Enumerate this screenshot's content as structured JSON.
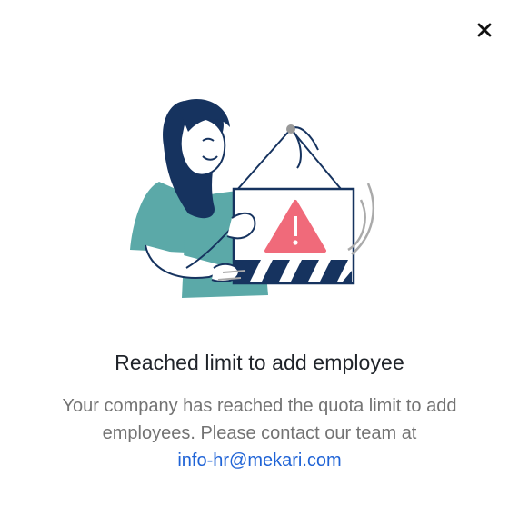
{
  "dialog": {
    "close_icon": "close-icon",
    "illustration": "woman-holding-warning-sign-illustration",
    "title": "Reached limit to add employee",
    "message_line1": "Your company has reached the quota limit to add",
    "message_line2": "employees. Please contact our team at",
    "contact_email": "info-hr@mekari.com"
  },
  "colors": {
    "title_text": "#1f2329",
    "body_text": "#737373",
    "link": "#1f63d6",
    "navy": "#16335f",
    "teal": "#5ba9a8",
    "warning_red": "#f06a7a"
  }
}
